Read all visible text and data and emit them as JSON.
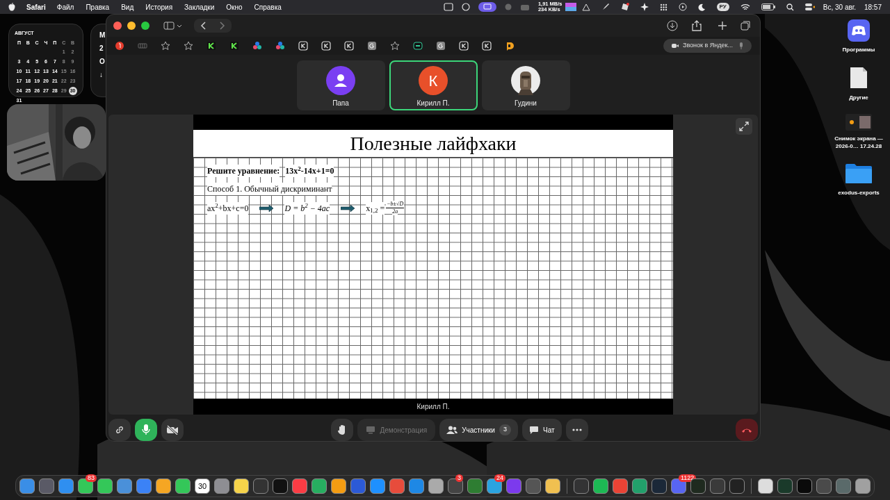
{
  "menu_bar": {
    "app": "Safari",
    "menus": [
      "Файл",
      "Правка",
      "Вид",
      "История",
      "Закладки",
      "Окно",
      "Справка"
    ],
    "net_up": "1,91 MB/s",
    "net_down": "234 KB/s",
    "input_source": "РУ",
    "date": "Вс, 30 авг.",
    "time": "18:57"
  },
  "calendar_widget": {
    "month": "АВГУСТ",
    "weekdays": [
      "П",
      "В",
      "С",
      "Ч",
      "П",
      "С",
      "В"
    ],
    "weeks": [
      [
        {
          "day": "1",
          "today": false
        },
        {
          "day": "2",
          "today": false
        }
      ],
      [
        {
          "day": "3",
          "today": false
        },
        {
          "day": "4",
          "today": false
        },
        {
          "day": "5",
          "today": false
        },
        {
          "day": "6",
          "today": false
        },
        {
          "day": "7",
          "today": false
        },
        {
          "day": "8",
          "today": false
        },
        {
          "day": "9",
          "today": false
        }
      ],
      [
        {
          "day": "10",
          "today": false
        },
        {
          "day": "11",
          "today": false
        },
        {
          "day": "12",
          "today": false
        },
        {
          "day": "13",
          "today": false
        },
        {
          "day": "14",
          "today": false
        },
        {
          "day": "15",
          "today": false
        },
        {
          "day": "16",
          "today": false
        }
      ],
      [
        {
          "day": "17",
          "today": false
        },
        {
          "day": "18",
          "today": false
        },
        {
          "day": "19",
          "today": false
        },
        {
          "day": "20",
          "today": false
        },
        {
          "day": "21",
          "today": false
        },
        {
          "day": "22",
          "today": false
        },
        {
          "day": "23",
          "today": false
        }
      ],
      [
        {
          "day": "24",
          "today": false
        },
        {
          "day": "25",
          "today": false
        },
        {
          "day": "26",
          "today": false
        },
        {
          "day": "27",
          "today": false
        },
        {
          "day": "28",
          "today": false
        },
        {
          "day": "29",
          "today": false
        },
        {
          "day": "30",
          "today": true
        }
      ],
      [
        {
          "day": "31",
          "today": false
        }
      ]
    ]
  },
  "second_widget": {
    "texts": [
      "М",
      "2",
      "О",
      "↓"
    ]
  },
  "browser": {
    "favorites": [
      {
        "kind": "yandex",
        "selected": false
      },
      {
        "kind": "bars",
        "selected": false
      },
      {
        "kind": "star",
        "selected": false
      },
      {
        "kind": "star",
        "selected": false
      },
      {
        "kind": "k-green",
        "selected": false
      },
      {
        "kind": "k-green",
        "selected": false
      },
      {
        "kind": "dots",
        "selected": false
      },
      {
        "kind": "dots",
        "selected": false
      },
      {
        "kind": "k",
        "selected": false
      },
      {
        "kind": "k",
        "selected": false
      },
      {
        "kind": "k",
        "selected": false
      },
      {
        "kind": "g",
        "selected": false
      },
      {
        "kind": "star",
        "selected": false
      },
      {
        "kind": "screen",
        "selected": false
      },
      {
        "kind": "g",
        "selected": false
      },
      {
        "kind": "k",
        "selected": false
      },
      {
        "kind": "k",
        "selected": false
      },
      {
        "kind": "d",
        "selected": false
      },
      {
        "kind": "tab",
        "label": "Звонок в Яндек...",
        "selected": true
      }
    ]
  },
  "call": {
    "participants": [
      {
        "name": "Папа",
        "kind": "person",
        "selected": false
      },
      {
        "name": "Кирилл П.",
        "kind": "letter",
        "initial": "К",
        "selected": true
      },
      {
        "name": "Гудини",
        "kind": "picture",
        "selected": false
      }
    ],
    "slide": {
      "title": "Полезные лайфхаки",
      "task_label": "Решите уравнение:",
      "task_equation": "13x$^{2}$-14x+1=0",
      "method": "Способ 1. Обычный дискриминант",
      "formula_general": "ax$^{2}$+bx+c=0",
      "formula_discriminant": "D = b$^{2}$ − 4ac",
      "roots_label": "x$_{1,2}$ =",
      "roots_numerator": "−b±√D",
      "roots_denominator": "2a"
    },
    "presenter": "Кирилл П.",
    "controls": {
      "mic": {
        "on": true
      },
      "camera": {
        "on": false
      },
      "screen_share": {
        "label": "Демонстрация",
        "disabled": true
      },
      "participants": {
        "label": "Участники",
        "count": "3"
      },
      "chat": {
        "label": "Чат"
      }
    }
  },
  "desktop_icons": [
    {
      "kind": "app",
      "label": "Программы"
    },
    {
      "kind": "document",
      "label": "Другие"
    },
    {
      "kind": "screenshot",
      "label": "Снимок экрана — 2026-0… 17.24.28"
    },
    {
      "kind": "folder",
      "label": "exodus-exports"
    }
  ],
  "dock": [
    {
      "color": "#3a8ee6"
    },
    {
      "color": "#5a5a66"
    },
    {
      "color": "#2f8ff0"
    },
    {
      "color": "#34c759",
      "badge": "83"
    },
    {
      "color": "#34c759"
    },
    {
      "color": "#4a90d9"
    },
    {
      "color": "#3b82f6"
    },
    {
      "color": "#f5a623"
    },
    {
      "color": "#34c759"
    },
    {
      "color": "#ffffff",
      "label": "30"
    },
    {
      "color": "#8e8e93"
    },
    {
      "color": "#f6d34a"
    },
    {
      "color": "#333333"
    },
    {
      "color": "#111111"
    },
    {
      "color": "#fc3c44"
    },
    {
      "color": "#27ae60"
    },
    {
      "color": "#f39c12"
    },
    {
      "color": "#2c5ad6"
    },
    {
      "color": "#1e90ff"
    },
    {
      "color": "#e74c3c"
    },
    {
      "color": "#1e88e5"
    },
    {
      "color": "#aaaaaa"
    },
    {
      "color": "#444444",
      "badge": "3"
    },
    {
      "color": "#2e7d32"
    },
    {
      "color": "#2aa3e0",
      "badge": "24"
    },
    {
      "color": "#7c3aed"
    },
    {
      "color": "#555555"
    },
    {
      "color": "#f0c050"
    },
    {
      "color": "#333334"
    },
    {
      "color": "#1db954"
    },
    {
      "color": "#ea4335"
    },
    {
      "color": "#22a06b"
    },
    {
      "color": "#1b2838"
    },
    {
      "color": "#5865f2",
      "badge": "1122"
    },
    {
      "color": "#1f2a1f"
    },
    {
      "color": "#3a3a3a"
    },
    {
      "color": "#222222"
    },
    {
      "color": "#dddddd"
    },
    {
      "color": "#1a3a2a"
    },
    {
      "color": "#0a0a0a"
    },
    {
      "color": "#4a4a4a"
    },
    {
      "color": "#5a6a6a"
    },
    {
      "color": "#a0a0a0"
    }
  ]
}
